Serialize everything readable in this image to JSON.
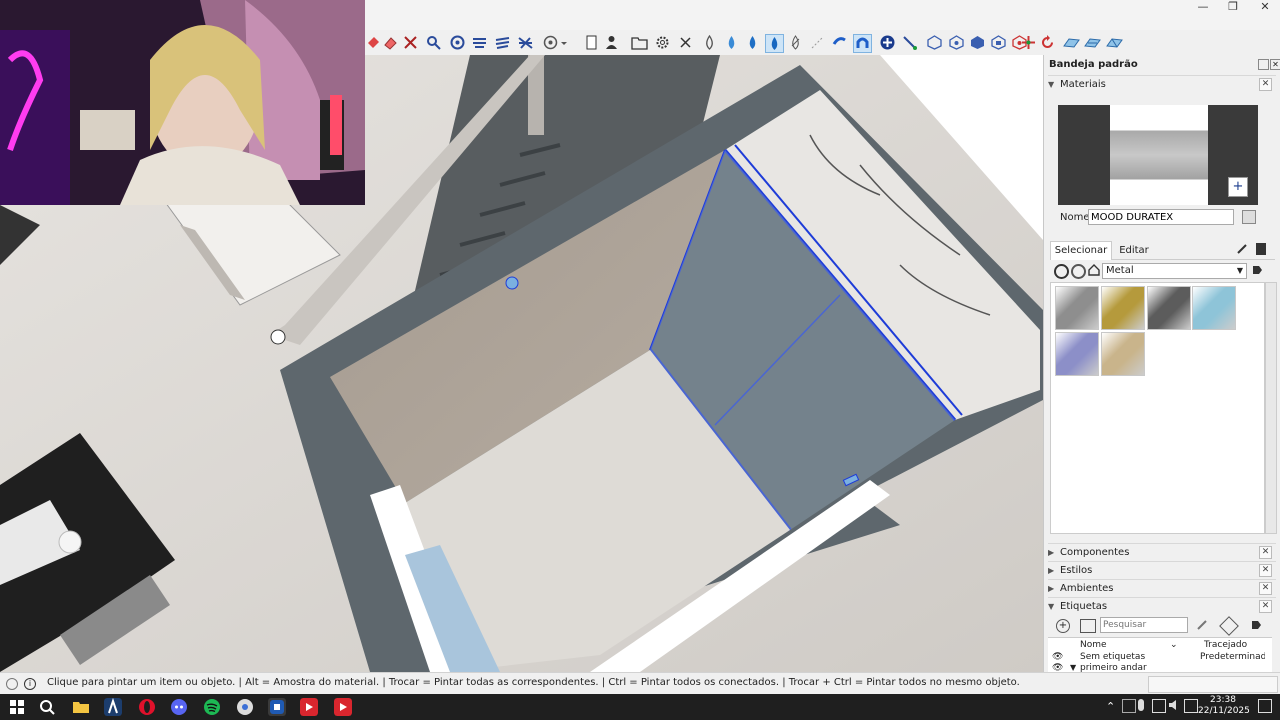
{
  "window": {
    "minimize": "—",
    "maximize": "❐",
    "close": "✕"
  },
  "toolbar": {
    "icons": [
      "paint-bucket-icon",
      "eraser-icon",
      "tape-measure-icon",
      "zoom-icon",
      "orbit-icon",
      "pan-icon",
      "walk-icon",
      "section-plane-icon",
      "look-around-icon",
      "dropdown-icon",
      "page-icon",
      "person-icon",
      "folder-icon",
      "gear-icon",
      "close-icon",
      "shape-1-icon",
      "shape-2-icon",
      "shape-3-icon",
      "shape-4-icon",
      "shape-5-icon",
      "shape-6-icon",
      "magnet-icon",
      "magnet-active-icon",
      "add-icon",
      "line-tool-icon",
      "solid-1-icon",
      "solid-2-icon",
      "solid-3-icon",
      "solid-4-icon",
      "solid-5-icon",
      "axes-icon",
      "rotate-icon",
      "terrain-1-icon",
      "terrain-2-icon",
      "terrain-3-icon"
    ]
  },
  "tray": {
    "title": "Bandeja padrão",
    "materials_label": "Materiais",
    "name_label": "Nome",
    "name_value": "MOOD DURATEX",
    "tab_select": "Selecionar",
    "tab_edit": "Editar",
    "category": "Metal",
    "swatch_colors": [
      "#8e8e8e",
      "#b59a3c",
      "#5c5c5c",
      "#8ec4d8",
      "#8c8fc8",
      "#c9b48b"
    ],
    "sections": [
      "Componentes",
      "Estilos",
      "Ambientes",
      "Etiquetas"
    ],
    "search_placeholder": "Pesquisar",
    "col_name": "Nome",
    "col_trace": "Tracejado",
    "rows": [
      {
        "name": "Sem etiquetas",
        "trace": "Predeterminado"
      },
      {
        "name": "primeiro andar",
        "trace": ""
      }
    ]
  },
  "status": {
    "message": "Clique para pintar um item ou objeto. | Alt = Amostra do material. | Trocar = Pintar todas as correspondentes. | Ctrl = Pintar todos os conectados. | Trocar + Ctrl = Pintar todos no mesmo objeto."
  },
  "taskbar": {
    "time": "23:38",
    "date": "22/11/2025",
    "tray_chevron": "⌃"
  },
  "colors": {
    "accent": "#1e3cd8",
    "floor": "#dcd9d5",
    "wall": "#5e676d",
    "brown_wall": "#a39a8f"
  }
}
